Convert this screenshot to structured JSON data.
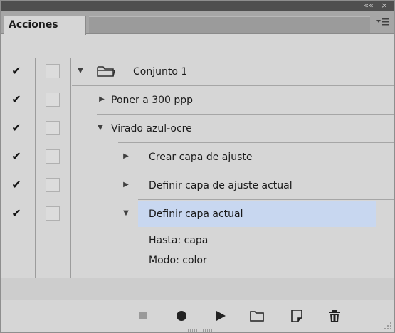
{
  "panel": {
    "tab_label": "Acciones",
    "top_buttons": [
      "««",
      "×"
    ],
    "menu_icon": "panel-menu-icon"
  },
  "actions": [
    {
      "label": "Conjunto 1",
      "checked": true,
      "expanded": true,
      "level": 0,
      "kind": "set"
    },
    {
      "label": "Poner a 300 ppp",
      "checked": true,
      "expanded": false,
      "level": 1,
      "kind": "action"
    },
    {
      "label": "Virado azul-ocre",
      "checked": true,
      "expanded": true,
      "level": 1,
      "kind": "action"
    },
    {
      "label": "Crear capa de ajuste",
      "checked": true,
      "expanded": false,
      "level": 2,
      "kind": "command"
    },
    {
      "label": "Definir capa de ajuste actual",
      "checked": true,
      "expanded": false,
      "level": 2,
      "kind": "command"
    },
    {
      "label": "Definir capa actual",
      "checked": true,
      "expanded": true,
      "level": 2,
      "kind": "command",
      "selected": true
    }
  ],
  "details": [
    "Hasta: capa",
    "Modo: color"
  ],
  "toolbar": {
    "buttons": [
      "stop-icon",
      "record-icon",
      "play-icon",
      "new-set-icon",
      "new-action-icon",
      "delete-icon"
    ]
  },
  "colors": {
    "selection": "#c8d7f0",
    "panel_bg": "#d6d6d6"
  }
}
